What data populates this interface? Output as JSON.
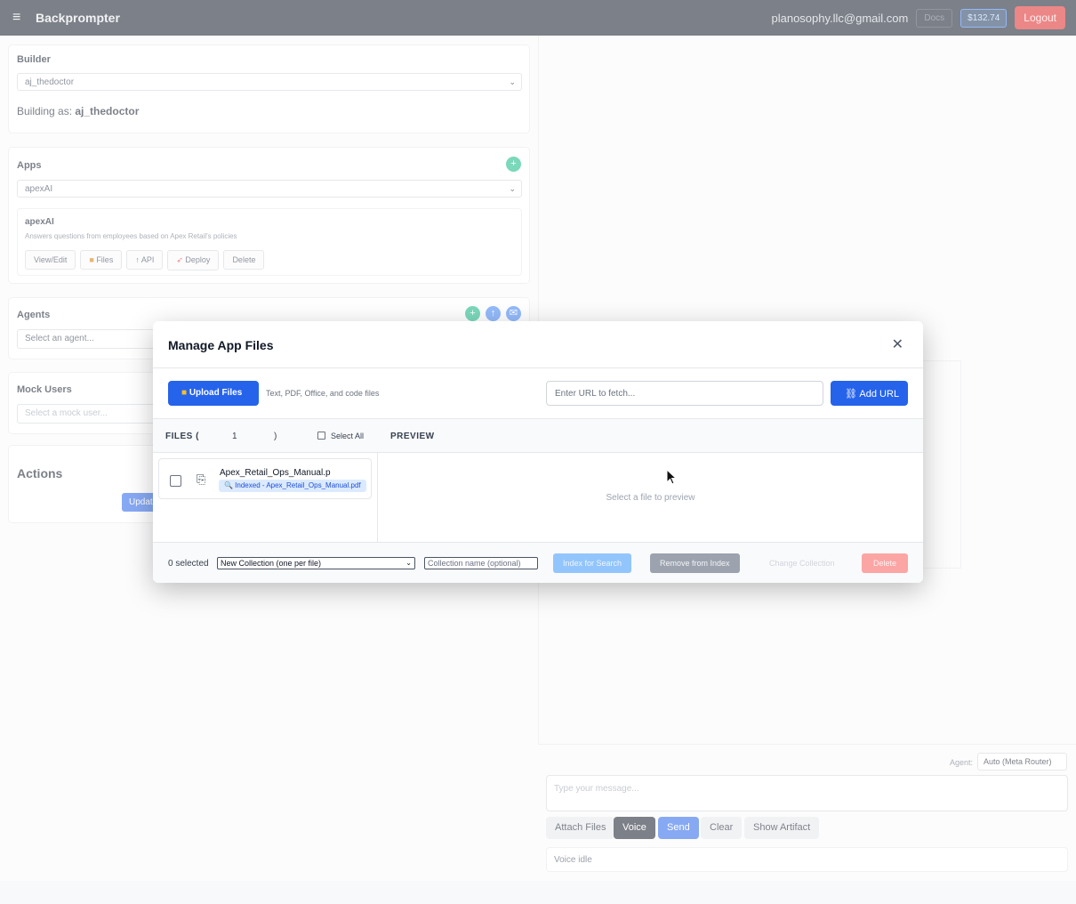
{
  "topbar": {
    "brand": "Backprompter",
    "email": "planosophy.llc@gmail.com",
    "docs_label": "Docs",
    "credit": "$132.74",
    "logout_label": "Logout"
  },
  "builder": {
    "title": "Builder",
    "selected": "aj_thedoctor",
    "building_as_prefix": "Building as: ",
    "building_as_name": "aj_thedoctor"
  },
  "apps": {
    "title": "Apps",
    "add_icon": "+",
    "selected": "apexAI",
    "app_name": "apexAI",
    "app_desc": "Answers questions from employees based on Apex Retail's policies",
    "buttons": {
      "view_edit": "View/Edit",
      "files": "Files",
      "api": "API",
      "deploy": "Deploy",
      "delete": "Delete"
    }
  },
  "agents": {
    "title": "Agents",
    "placeholder": "Select an agent..."
  },
  "mock_users": {
    "title": "Mock Users",
    "placeholder": "Select a mock user..."
  },
  "actions": {
    "title": "Actions",
    "update_label": "Update"
  },
  "chat": {
    "agent_label": "Agent:",
    "agent_selected": "Auto (Meta Router)",
    "input_placeholder": "Type your message...",
    "attach_label": "Attach Files",
    "voice_label": "Voice",
    "send_label": "Send",
    "clear_label": "Clear",
    "artifact_label": "Show Artifact",
    "voice_status": "Voice idle"
  },
  "modal": {
    "title": "Manage App Files",
    "close": "✕",
    "upload_label": "Upload Files",
    "upload_hint": "Text, PDF, Office, and code files",
    "url_placeholder": "Enter URL to fetch...",
    "add_url_label": "Add URL",
    "files_label": "FILES (",
    "files_count": "1",
    "files_close_paren": ")",
    "select_all_label": "Select All",
    "preview_label": "PREVIEW",
    "preview_empty": "Select a file to preview",
    "files": [
      {
        "name": "Apex_Retail_Ops_Manual.p",
        "badge": "🔍 Indexed - Apex_Retail_Ops_Manual.pdf"
      }
    ],
    "footer": {
      "selected_text": "0 selected",
      "collection_option": "New Collection (one per file)",
      "collection_name_placeholder": "Collection name (optional)",
      "index_label": "Index for Search",
      "remove_label": "Remove from Index",
      "change_label": "Change Collection",
      "delete_label": "Delete"
    }
  },
  "colors": {
    "primary": "#2563eb",
    "danger": "#dc2626",
    "topbar": "#111827",
    "success": "#10b981"
  }
}
